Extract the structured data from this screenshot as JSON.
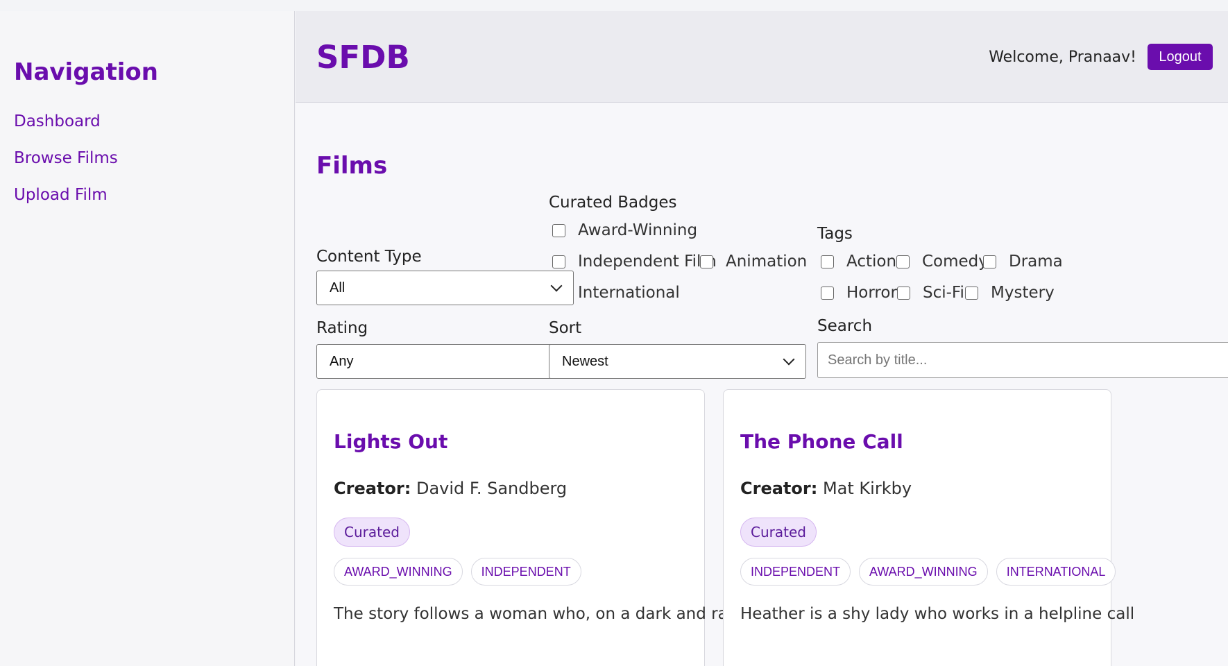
{
  "sidebar": {
    "title": "Navigation",
    "items": [
      {
        "label": "Dashboard"
      },
      {
        "label": "Browse Films"
      },
      {
        "label": "Upload Film"
      }
    ]
  },
  "header": {
    "brand": "SFDB",
    "welcome": "Welcome, Pranaav!",
    "logout_label": "Logout"
  },
  "page": {
    "title": "Films"
  },
  "filters": {
    "content_type": {
      "label": "Content Type",
      "value": "All"
    },
    "rating": {
      "label": "Rating",
      "value": "Any"
    },
    "sort": {
      "label": "Sort",
      "value": "Newest"
    },
    "search": {
      "label": "Search",
      "placeholder": "Search by title..."
    },
    "curated_badges": {
      "label": "Curated Badges",
      "options": [
        "Award-Winning",
        "Independent Film",
        "Animation",
        "International"
      ]
    },
    "tags": {
      "label": "Tags",
      "options": [
        "Action",
        "Comedy",
        "Drama",
        "Horror",
        "Sci-Fi",
        "Mystery"
      ]
    }
  },
  "films": [
    {
      "title": "Lights Out",
      "creator_label": "Creator:",
      "creator": "David F. Sandberg",
      "badge": "Curated",
      "tags": [
        "AWARD_WINNING",
        "INDEPENDENT"
      ],
      "description": "The story follows a woman who, on a dark and rainy"
    },
    {
      "title": "The Phone Call",
      "creator_label": "Creator:",
      "creator": "Mat Kirkby",
      "badge": "Curated",
      "tags": [
        "INDEPENDENT",
        "AWARD_WINNING",
        "INTERNATIONAL"
      ],
      "description": "Heather is a shy lady who works in a helpline call"
    }
  ],
  "colors": {
    "accent": "#6a0dad",
    "badge_bg": "#efe3fb"
  }
}
